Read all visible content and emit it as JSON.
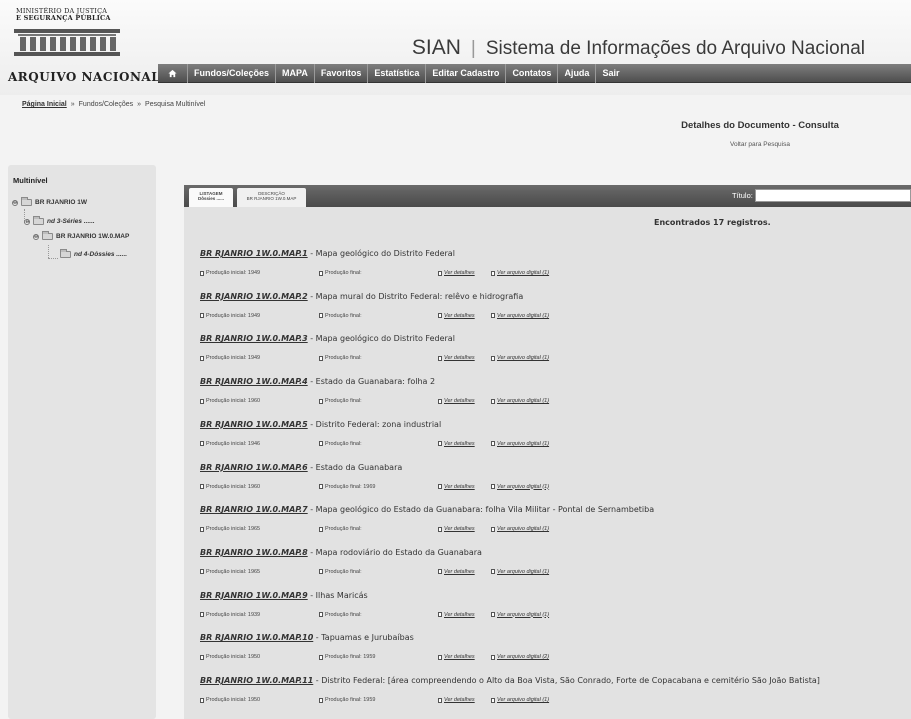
{
  "header": {
    "ministry_line1": "MINISTÉRIO DA JUSTIÇA",
    "ministry_line2": "E SEGURANÇA PÚBLICA",
    "institution": "ARQUIVO NACIONAL",
    "site_short": "SIAN",
    "site_name": "Sistema de Informações do Arquivo Nacional"
  },
  "nav": {
    "home_icon": "home-icon",
    "items": [
      {
        "label": "Fundos/Coleções"
      },
      {
        "label": "MAPA"
      },
      {
        "label": "Favoritos"
      },
      {
        "label": "Estatística"
      },
      {
        "label": "Editar Cadastro"
      },
      {
        "label": "Contatos"
      },
      {
        "label": "Ajuda"
      },
      {
        "label": "Sair"
      }
    ]
  },
  "breadcrumb": {
    "home": "Página Inicial",
    "sep": "»",
    "crumb2": "Fundos/Coleções",
    "crumb3": "Pesquisa Multinível"
  },
  "page": {
    "title": "Detalhes do Documento - Consulta",
    "back": "Voltar para Pesquisa"
  },
  "sidebar": {
    "header": "Multinível",
    "tree": [
      {
        "label": "BR RJANRIO 1W",
        "toggle": "⊖"
      },
      {
        "label": "nd 3-Séries ......",
        "toggle": "⊖"
      },
      {
        "label": "BR RJANRIO 1W.0.MAP",
        "toggle": "⊖"
      },
      {
        "label": "nd 4-Dôssies ......"
      }
    ]
  },
  "tabs": {
    "listagem_line1": "LISTAGEM",
    "listagem_line2": "Dôssies ......",
    "descricao_line1": "DESCRIÇÃO",
    "descricao_line2": "BR RJANRIO 1W.0.MAP"
  },
  "search": {
    "titulo_label": "Título:",
    "titulo_value": ""
  },
  "results": {
    "found_text": "Encontrados 17 registros.",
    "prod_ini_label": "Produção inicial:",
    "prod_fin_label": "Produção final:",
    "details_link": "Ver detalhes",
    "records": [
      {
        "code": "BR RJANRIO 1W.0.MAP.1",
        "title": " - Mapa geológico do Distrito Federal",
        "prod_ini": "Produção inicial: 1949",
        "prod_fin": "Produção final:",
        "digital": "Ver arquivo digital (1)"
      },
      {
        "code": "BR RJANRIO 1W.0.MAP.2",
        "title": " - Mapa mural do Distrito Federal: relêvo e hidrografia",
        "prod_ini": "Produção inicial: 1949",
        "prod_fin": "Produção final:",
        "digital": "Ver arquivo digital (1)"
      },
      {
        "code": "BR RJANRIO 1W.0.MAP.3",
        "title": " - Mapa geológico do Distrito Federal",
        "prod_ini": "Produção inicial: 1949",
        "prod_fin": "Produção final:",
        "digital": "Ver arquivo digital (1)"
      },
      {
        "code": "BR RJANRIO 1W.0.MAP.4",
        "title": " - Estado da Guanabara: folha 2",
        "prod_ini": "Produção inicial: 1960",
        "prod_fin": "Produção final:",
        "digital": "Ver arquivo digital (1)"
      },
      {
        "code": "BR RJANRIO 1W.0.MAP.5",
        "title": " - Distrito Federal: zona industrial",
        "prod_ini": "Produção inicial: 1946",
        "prod_fin": "Produção final:",
        "digital": "Ver arquivo digital (1)"
      },
      {
        "code": "BR RJANRIO 1W.0.MAP.6",
        "title": " - Estado da Guanabara",
        "prod_ini": "Produção inicial: 1960",
        "prod_fin": "Produção final: 1969",
        "digital": "Ver arquivo digital (1)"
      },
      {
        "code": "BR RJANRIO 1W.0.MAP.7",
        "title": " - Mapa geológico do Estado da Guanabara: folha Vila Militar - Pontal de Sernambetiba",
        "prod_ini": "Produção inicial: 1965",
        "prod_fin": "Produção final:",
        "digital": "Ver arquivo digital (1)"
      },
      {
        "code": "BR RJANRIO 1W.0.MAP.8",
        "title": " - Mapa rodoviário do Estado da Guanabara",
        "prod_ini": "Produção inicial: 1965",
        "prod_fin": "Produção final:",
        "digital": "Ver arquivo digital (1)"
      },
      {
        "code": "BR RJANRIO 1W.0.MAP.9",
        "title": " - Ilhas Maricás",
        "prod_ini": "Produção inicial: 1939",
        "prod_fin": "Produção final:",
        "digital": "Ver arquivo digital (1)"
      },
      {
        "code": "BR RJANRIO 1W.0.MAP.10",
        "title": " - Tapuamas e Jurubaíbas",
        "prod_ini": "Produção inicial: 1950",
        "prod_fin": "Produção final: 1959",
        "digital": "Ver arquivo digital (2)"
      },
      {
        "code": "BR RJANRIO 1W.0.MAP.11",
        "title": " - Distrito Federal: [área compreendendo o Alto da Boa Vista, São Conrado, Forte de Copacabana e cemitério São João Batista]",
        "prod_ini": "Produção inicial: 1950",
        "prod_fin": "Produção final: 1959",
        "digital": "Ver arquivo digital (1)"
      }
    ]
  }
}
